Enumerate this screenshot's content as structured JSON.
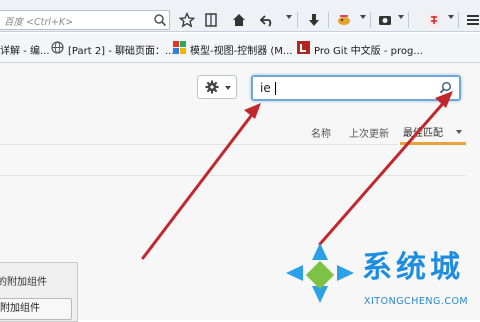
{
  "toolbar": {
    "search_placeholder": "百度 <Ctrl+K>",
    "icons": [
      "star-icon",
      "reading-list-icon",
      "home-icon",
      "back-undo-icon",
      "download-icon",
      "extension-icon",
      "screenshot-icon",
      "fortune-icon",
      "menu-icon"
    ]
  },
  "bookmarks": [
    {
      "label": "详解 - 编...",
      "icon": "bookmark-icon"
    },
    {
      "label": "[Part 2] - 聊础页面：...",
      "icon": "globe-icon"
    },
    {
      "label": "模型-视图-控制器 (M...",
      "icon": "colorful-icon"
    },
    {
      "label": "Pro Git 中文版 - prog...",
      "icon": "git-book-icon"
    }
  ],
  "addons": {
    "search_value": "ie",
    "sort": {
      "name_label": "名称",
      "last_updated_label": "上次更新",
      "best_match_label": "最佳匹配"
    },
    "panel": {
      "text": "的附加组件",
      "button_label": "附加组件"
    }
  },
  "watermark": {
    "brand": "系统城",
    "url": "XITONGCHENG.COM"
  },
  "colors": {
    "search_focus": "#6ea7d8",
    "sort_underline": "#e8a33a",
    "arrow": "#c0282d",
    "watermark": "#1c8de0"
  }
}
